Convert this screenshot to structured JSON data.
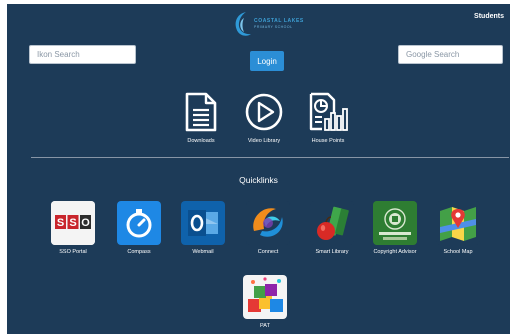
{
  "header": {
    "brand_name": "COASTAL LAKES",
    "brand_tagline": "PRIMARY SCHOOL",
    "audience_link": "Students"
  },
  "search": {
    "left_placeholder": "Ikon Search",
    "right_placeholder": "Google Search"
  },
  "login_label": "Login",
  "top_tiles": [
    {
      "label": "Downloads",
      "icon": "document-icon"
    },
    {
      "label": "Video Library",
      "icon": "play-icon"
    },
    {
      "label": "House Points",
      "icon": "report-chart-icon"
    }
  ],
  "quicklinks": {
    "heading": "Quicklinks",
    "apps": [
      {
        "label": "SSO Portal",
        "icon": "sso-icon"
      },
      {
        "label": "Compass",
        "icon": "compass-icon"
      },
      {
        "label": "Webmail",
        "icon": "outlook-icon"
      },
      {
        "label": "Connect",
        "icon": "connect-icon"
      },
      {
        "label": "Smart Library",
        "icon": "books-apple-icon"
      },
      {
        "label": "Copyright Advisor",
        "icon": "copyright-seal-icon"
      },
      {
        "label": "School Map",
        "icon": "map-icon"
      },
      {
        "label": "PAT",
        "icon": "pat-cubes-icon"
      }
    ]
  },
  "colors": {
    "background": "#1d3b58",
    "accent": "#2b8ed6",
    "brand": "#3d9fd4"
  }
}
